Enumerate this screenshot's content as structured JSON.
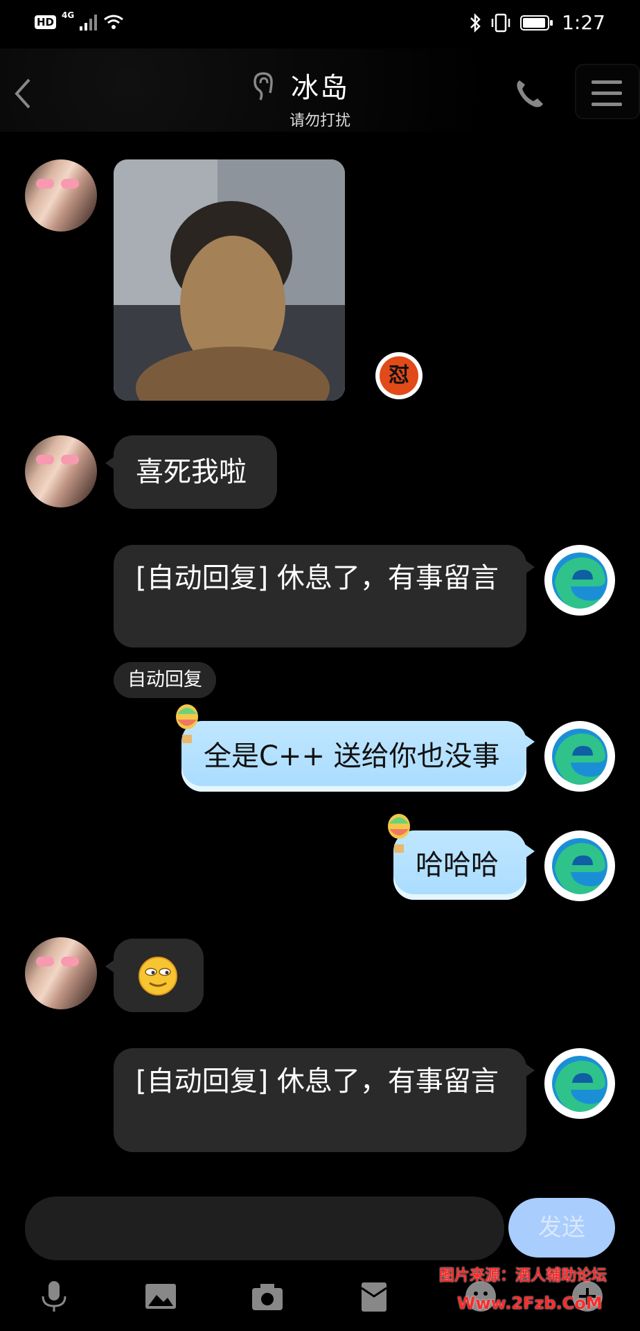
{
  "status_bar": {
    "hd": "HD",
    "network": "4G",
    "time": "1:27"
  },
  "header": {
    "title": "冰岛",
    "subtitle": "请勿打扰"
  },
  "messages": {
    "m2": "喜死我啦",
    "m3": "[自动回复] 休息了，有事留言",
    "auto_tag": "自动回复",
    "m4": "全是C++ 送给你也没事",
    "m5": "哈哈哈",
    "m7": "[自动回复] 休息了，有事留言"
  },
  "reaction_badge": "怼",
  "input": {
    "placeholder": "",
    "send_label": "发送"
  },
  "watermark": {
    "line1": "图片来源：酒人辅助论坛",
    "line2": "Www.2Fzb.CoM"
  },
  "colors": {
    "bubble": "#2a2a2a",
    "cloud_bubble": "#bfe6ff",
    "send_button": "#a9cdfc",
    "watermark": "#ff2a2a"
  }
}
